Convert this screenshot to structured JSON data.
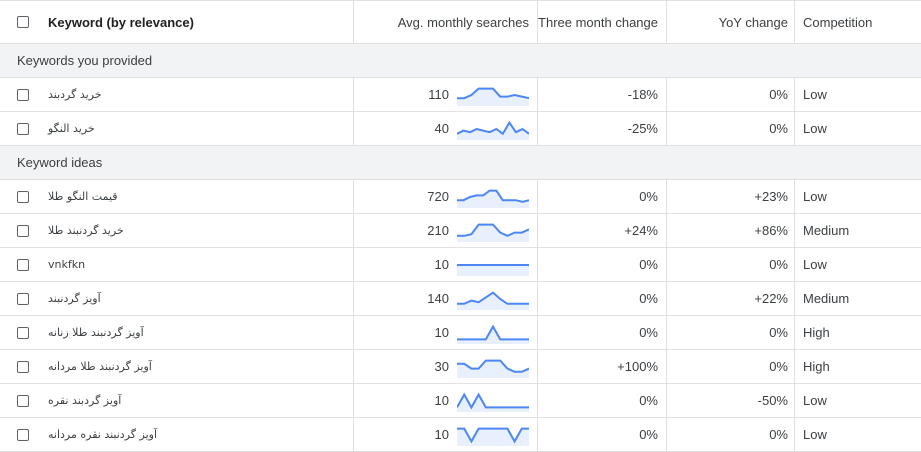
{
  "header": {
    "keyword": "Keyword (by relevance)",
    "avg": "Avg. monthly searches",
    "three_month": "Three month change",
    "yoy": "YoY change",
    "competition": "Competition"
  },
  "groups": {
    "provided": "Keywords you provided",
    "ideas": "Keyword ideas"
  },
  "rows": [
    {
      "keyword": "خرید گردبند",
      "avg": "110",
      "three": "-18%",
      "yoy": "0%",
      "comp": "Low",
      "trend": [
        0.3,
        0.3,
        0.5,
        0.9,
        0.9,
        0.9,
        0.4,
        0.4,
        0.5,
        0.4,
        0.3
      ]
    },
    {
      "keyword": "خرید النگو",
      "avg": "40",
      "three": "-25%",
      "yoy": "0%",
      "comp": "Low",
      "trend": [
        0.2,
        0.4,
        0.3,
        0.5,
        0.4,
        0.3,
        0.5,
        0.2,
        0.9,
        0.3,
        0.5,
        0.2
      ]
    },
    {
      "keyword": "قیمت النگو طلا",
      "avg": "720",
      "three": "0%",
      "yoy": "+23%",
      "comp": "Low",
      "trend": [
        0.3,
        0.3,
        0.5,
        0.6,
        0.6,
        0.9,
        0.9,
        0.3,
        0.3,
        0.3,
        0.2,
        0.3
      ]
    },
    {
      "keyword": "خرید گردنبند طلا",
      "avg": "210",
      "three": "+24%",
      "yoy": "+86%",
      "comp": "Medium",
      "trend": [
        0.2,
        0.2,
        0.3,
        0.9,
        0.9,
        0.9,
        0.4,
        0.2,
        0.4,
        0.4,
        0.6
      ]
    },
    {
      "keyword": "vnkfkn",
      "avg": "10",
      "three": "0%",
      "yoy": "0%",
      "comp": "Low",
      "trend": [
        0.5,
        0.5,
        0.5,
        0.5,
        0.5,
        0.5,
        0.5,
        0.5,
        0.5,
        0.5,
        0.5
      ]
    },
    {
      "keyword": "آویز گردنبند",
      "avg": "140",
      "three": "0%",
      "yoy": "+22%",
      "comp": "Medium",
      "trend": [
        0.2,
        0.2,
        0.4,
        0.3,
        0.6,
        0.9,
        0.5,
        0.2,
        0.2,
        0.2,
        0.2
      ]
    },
    {
      "keyword": "آویز گردنبند طلا زنانه",
      "avg": "10",
      "three": "0%",
      "yoy": "0%",
      "comp": "High",
      "trend": [
        0.1,
        0.1,
        0.1,
        0.1,
        0.1,
        0.9,
        0.1,
        0.1,
        0.1,
        0.1,
        0.1
      ]
    },
    {
      "keyword": "آویز گردنبند طلا مردانه",
      "avg": "30",
      "three": "+100%",
      "yoy": "0%",
      "comp": "High",
      "trend": [
        0.7,
        0.7,
        0.4,
        0.4,
        0.9,
        0.9,
        0.9,
        0.4,
        0.2,
        0.2,
        0.4
      ]
    },
    {
      "keyword": "آویز گردبند نقره",
      "avg": "10",
      "three": "0%",
      "yoy": "-50%",
      "comp": "Low",
      "trend": [
        0.1,
        0.9,
        0.1,
        0.9,
        0.1,
        0.1,
        0.1,
        0.1,
        0.1,
        0.1,
        0.1
      ]
    },
    {
      "keyword": "آویز گردنبند نقره مردانه",
      "avg": "10",
      "three": "0%",
      "yoy": "0%",
      "comp": "Low",
      "trend": [
        0.9,
        0.9,
        0.1,
        0.9,
        0.9,
        0.9,
        0.9,
        0.9,
        0.1,
        0.9,
        0.9
      ]
    }
  ],
  "colors": {
    "spark_line": "#4d86f5",
    "spark_fill": "#e8f0fe",
    "group_bg": "#f1f3f4"
  }
}
